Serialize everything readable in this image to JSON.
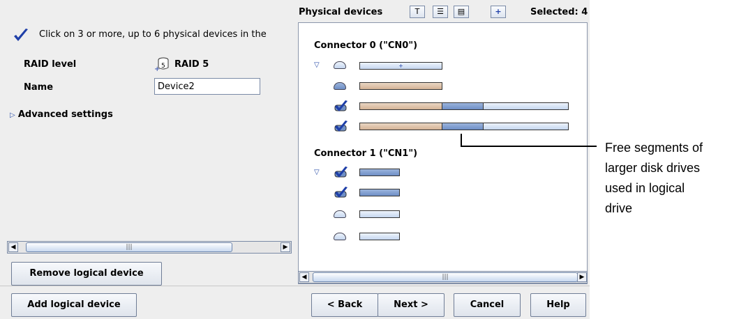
{
  "left": {
    "instruction": "Click on 3 or more, up to 6 physical devices in the",
    "raid_label": "RAID level",
    "raid_value": "RAID 5",
    "raid_icon_num": "5",
    "name_label": "Name",
    "name_value": "Device2",
    "advanced": "Advanced settings",
    "remove_button": "Remove logical device",
    "scroll_mark": "|||"
  },
  "right": {
    "title": "Physical devices",
    "selected": "Selected: 4",
    "tool_t": "T",
    "tool_plus": "+",
    "connector0": "Connector 0 (\"CN0\")",
    "connector1": "Connector 1 (\"CN1\")",
    "scroll_mark": "|||"
  },
  "footer": {
    "add_button": "Add logical device",
    "back_button": "< Back",
    "next_button": "Next >",
    "cancel_button": "Cancel",
    "help_button": "Help"
  },
  "callout": {
    "line1": "Free segments of",
    "line2": "larger disk drives",
    "line3": "used in logical",
    "line4": "drive"
  }
}
